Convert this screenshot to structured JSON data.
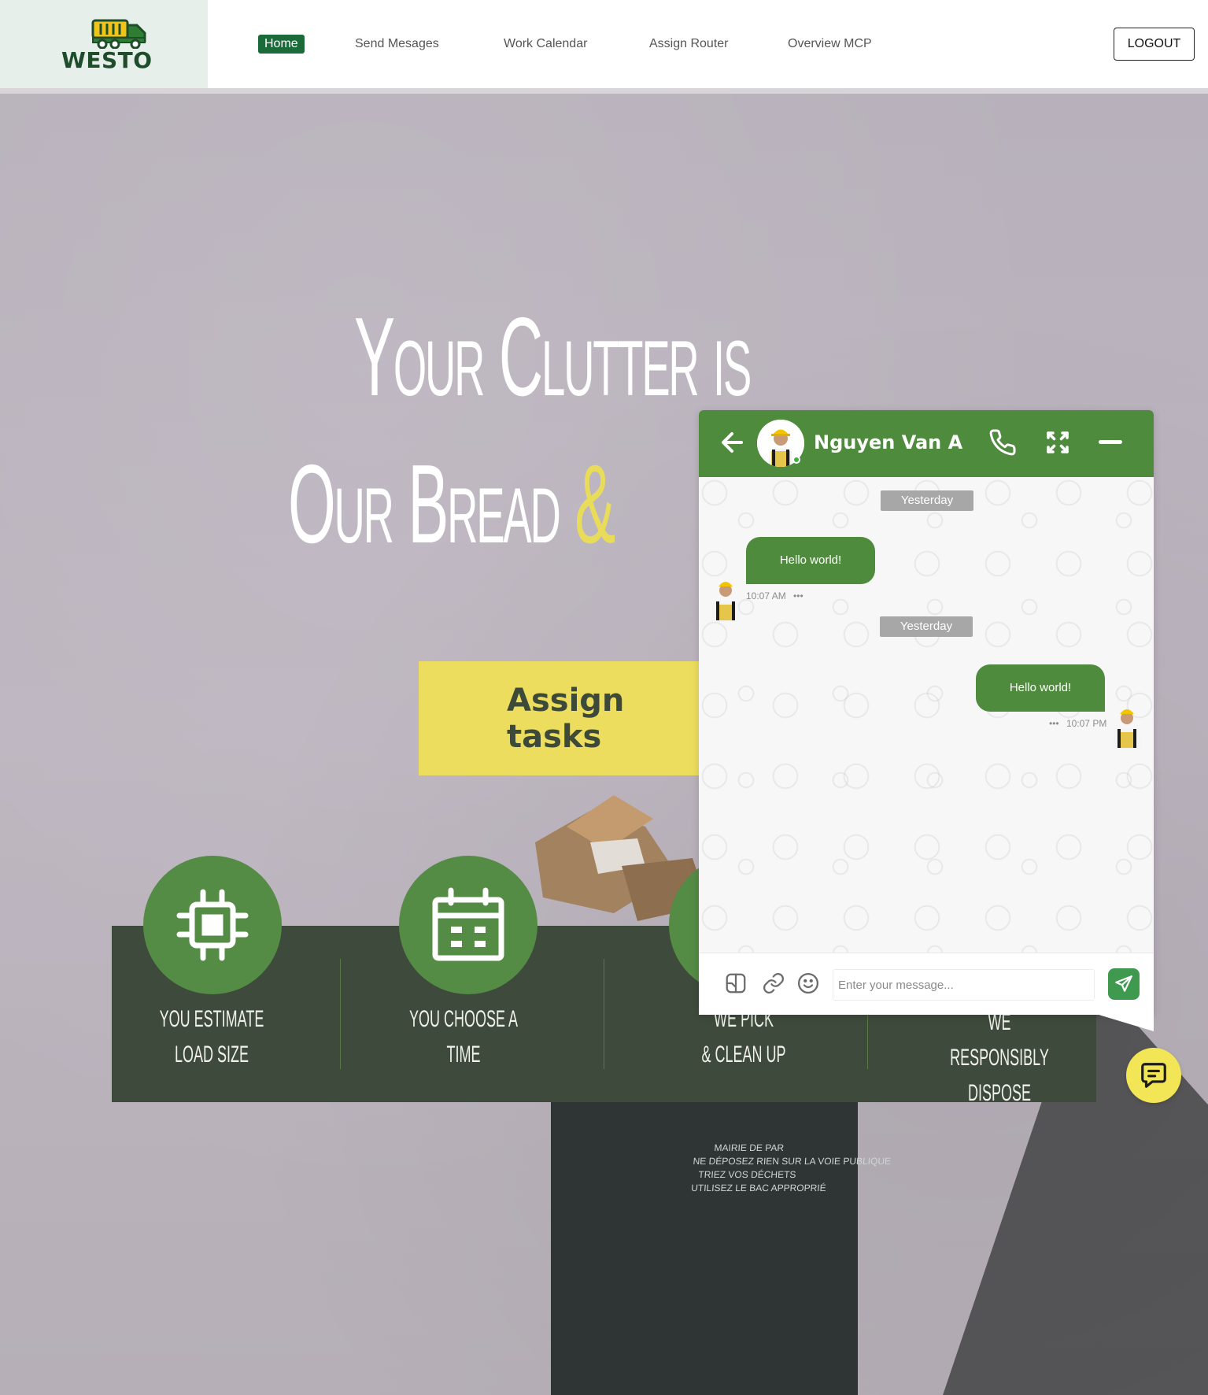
{
  "brand": {
    "name": "WESTO"
  },
  "nav": {
    "items": [
      {
        "label": "Home",
        "active": true
      },
      {
        "label": "Send Mesages",
        "active": false
      },
      {
        "label": "Work Calendar",
        "active": false
      },
      {
        "label": "Assign Router",
        "active": false
      },
      {
        "label": "Overview MCP",
        "active": false
      }
    ],
    "logout_label": "LOGOUT"
  },
  "hero": {
    "title_line1": "Your Clutter is",
    "title_line2_main": "Our Bread",
    "title_line2_accent": "&",
    "cta_label": "Assign tasks"
  },
  "bin_text": [
    "MAIRIE DE PAR",
    "NE DÉPOSEZ RIEN SUR LA VOIE PUBLIQUE",
    "TRIEZ VOS DÉCHETS",
    "UTILISEZ LE BAC APPROPRIÉ"
  ],
  "steps": [
    {
      "line1": "You Estimate",
      "line2": "Load Size",
      "icon": "chip-icon"
    },
    {
      "line1": "You Choose a",
      "line2": "Time",
      "icon": "calendar-icon"
    },
    {
      "line1": "We Pick",
      "line2": "& Clean up",
      "icon": "truck-icon"
    },
    {
      "line1": "We Responsibly",
      "line2": "dispose",
      "icon": "recycle-icon"
    }
  ],
  "chat": {
    "contact_name": "Nguyen Van A",
    "messages": [
      {
        "day": "Yesterday",
        "text": "Hello world!",
        "time": "10:07 AM",
        "direction": "in"
      },
      {
        "day": "Yesterday",
        "text": "Hello world!",
        "time": "10:07 PM",
        "direction": "out"
      }
    ],
    "input_placeholder": "Enter your message...",
    "dots": "•••"
  },
  "colors": {
    "brand_green": "#1b6a3a",
    "chat_green": "#4f8b3d",
    "step_green": "#548b45",
    "band": "#3e4a3b",
    "accent_yellow": "#ecdd5e"
  }
}
